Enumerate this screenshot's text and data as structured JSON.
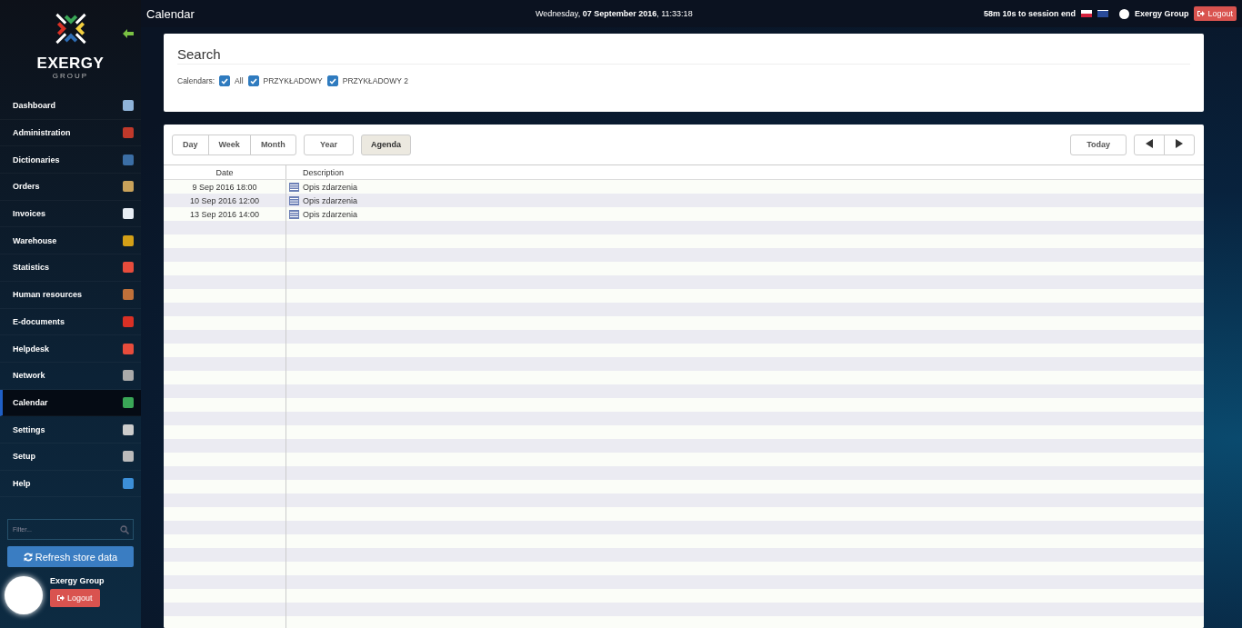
{
  "sidebar": {
    "logo_text": "EXERGY",
    "logo_subtext": "GROUP",
    "items": [
      {
        "label": "Dashboard",
        "selected": false
      },
      {
        "label": "Administration",
        "selected": false
      },
      {
        "label": "Dictionaries",
        "selected": false
      },
      {
        "label": "Orders",
        "selected": false
      },
      {
        "label": "Invoices",
        "selected": false
      },
      {
        "label": "Warehouse",
        "selected": false
      },
      {
        "label": "Statistics",
        "selected": false
      },
      {
        "label": "Human resources",
        "selected": false
      },
      {
        "label": "E-documents",
        "selected": false
      },
      {
        "label": "Helpdesk",
        "selected": false
      },
      {
        "label": "Network",
        "selected": false
      },
      {
        "label": "Calendar",
        "selected": true
      },
      {
        "label": "Settings",
        "selected": false
      },
      {
        "label": "Setup",
        "selected": false
      },
      {
        "label": "Help",
        "selected": false
      }
    ],
    "filter": {
      "placeholder": "Filter..."
    },
    "refresh_button": "Refresh store data",
    "user": {
      "name": "Exergy Group",
      "logout": "Logout"
    }
  },
  "header": {
    "title": "Calendar",
    "datetime": "Wednesday, **07 September 2016**, 11:33:18",
    "session": "58m 10s to session end",
    "user": "Exergy Group",
    "logout": "Logout"
  },
  "search": {
    "title": "Search",
    "calendars_label": "Calendars:",
    "calendars": [
      {
        "label": "All",
        "checked": true
      },
      {
        "label": "PRZYKŁADOWY",
        "checked": true
      },
      {
        "label": "PRZYKŁADOWY 2",
        "checked": true
      }
    ]
  },
  "views": [
    {
      "label": "Day",
      "selected": false
    },
    {
      "label": "Week",
      "selected": false
    },
    {
      "label": "Month",
      "selected": false
    },
    {
      "label": "Year",
      "selected": false
    },
    {
      "label": "Agenda",
      "selected": true
    }
  ],
  "today_button": "Today",
  "agenda": {
    "columns": [
      "Date",
      "Description"
    ],
    "rows": [
      {
        "date": "9 Sep 2016 18:00",
        "description": "Opis zdarzenia"
      },
      {
        "date": "10 Sep 2016 12:00",
        "description": "Opis zdarzenia"
      },
      {
        "date": "13 Sep 2016 14:00",
        "description": "Opis zdarzenia"
      }
    ]
  }
}
